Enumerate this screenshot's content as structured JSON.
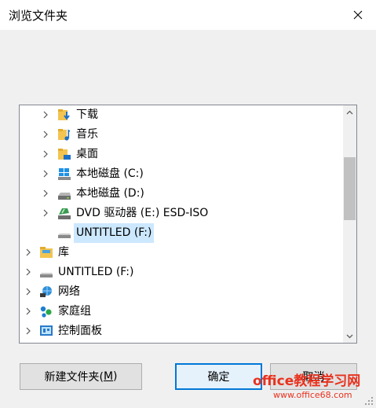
{
  "window": {
    "title": "浏览文件夹",
    "close_icon": "close-icon"
  },
  "tree": {
    "items": [
      {
        "label": "下载",
        "icon": "downloads-folder-icon",
        "expandable": true,
        "level": 2,
        "selected": false
      },
      {
        "label": "音乐",
        "icon": "music-folder-icon",
        "expandable": true,
        "level": 2,
        "selected": false
      },
      {
        "label": "桌面",
        "icon": "desktop-folder-icon",
        "expandable": true,
        "level": 2,
        "selected": false
      },
      {
        "label": "本地磁盘 (C:)",
        "icon": "windows-drive-icon",
        "expandable": true,
        "level": 2,
        "selected": false
      },
      {
        "label": "本地磁盘 (D:)",
        "icon": "drive-icon",
        "expandable": true,
        "level": 2,
        "selected": false
      },
      {
        "label": "DVD 驱动器 (E:) ESD-ISO",
        "icon": "dvd-drive-icon",
        "expandable": true,
        "level": 2,
        "selected": false
      },
      {
        "label": "UNTITLED (F:)",
        "icon": "removable-drive-icon",
        "expandable": false,
        "level": 2,
        "selected": true
      },
      {
        "label": "库",
        "icon": "library-icon",
        "expandable": true,
        "level": 1,
        "selected": false
      },
      {
        "label": "UNTITLED (F:)",
        "icon": "removable-drive-icon",
        "expandable": true,
        "level": 1,
        "selected": false
      },
      {
        "label": "网络",
        "icon": "network-icon",
        "expandable": true,
        "level": 1,
        "selected": false
      },
      {
        "label": "家庭组",
        "icon": "homegroup-icon",
        "expandable": true,
        "level": 1,
        "selected": false
      },
      {
        "label": "控制面板",
        "icon": "control-panel-icon",
        "expandable": true,
        "level": 1,
        "selected": false
      }
    ]
  },
  "buttons": {
    "new_folder_prefix": "新建文件夹(",
    "new_folder_accel": "M",
    "new_folder_suffix": ")",
    "ok": "确定",
    "cancel": "取消"
  },
  "watermark": {
    "main": "office教程学习网",
    "sub": "www.office68.com"
  },
  "colors": {
    "selection": "#cce8ff",
    "default_button_border": "#0078d7",
    "watermark": "#e8321e"
  }
}
